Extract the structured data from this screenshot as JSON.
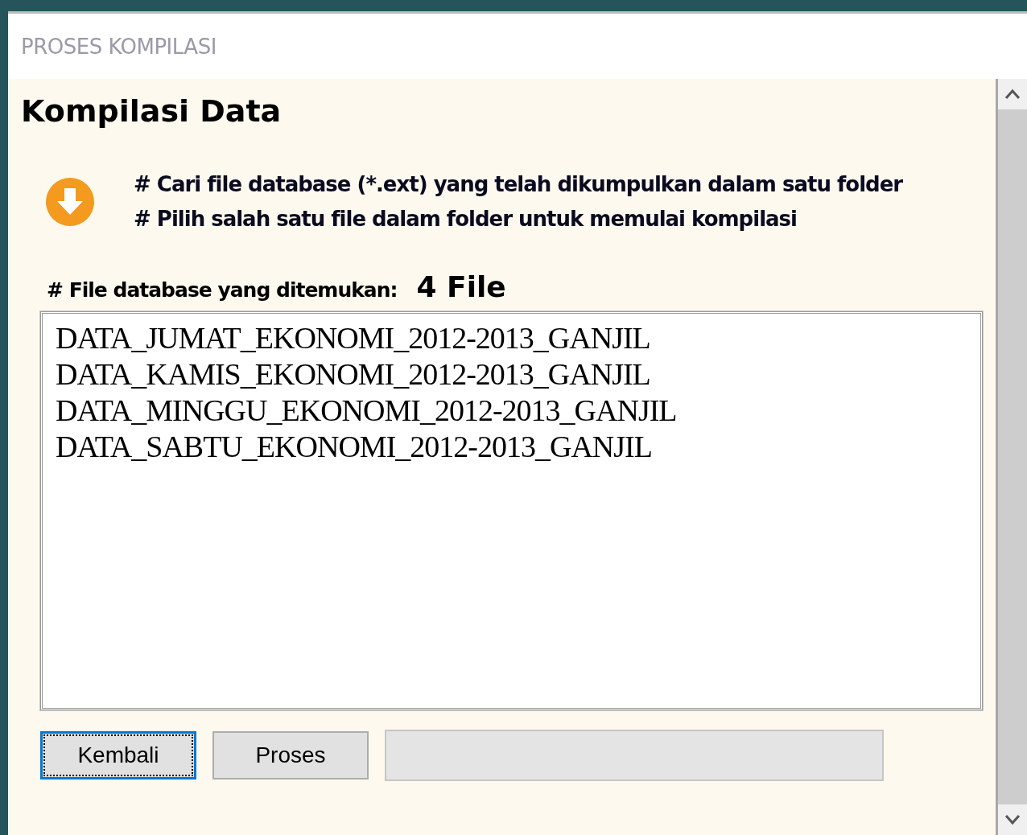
{
  "window": {
    "title": "PROSES KOMPILASI"
  },
  "heading": "Kompilasi Data",
  "instructions": [
    "# Cari file database (*.ext) yang telah dikumpulkan dalam satu folder",
    "# Pilih salah satu file dalam folder untuk memulai kompilasi"
  ],
  "found": {
    "label": "# File database yang ditemukan:",
    "count": "4 File"
  },
  "files": [
    "DATA_JUMAT_EKONOMI_2012-2013_GANJIL",
    "DATA_KAMIS_EKONOMI_2012-2013_GANJIL",
    "DATA_MINGGU_EKONOMI_2012-2013_GANJIL",
    "DATA_SABTU_EKONOMI_2012-2013_GANJIL"
  ],
  "buttons": [
    {
      "label": "Kembali",
      "focused": true
    },
    {
      "label": "Proses",
      "focused": false
    }
  ]
}
